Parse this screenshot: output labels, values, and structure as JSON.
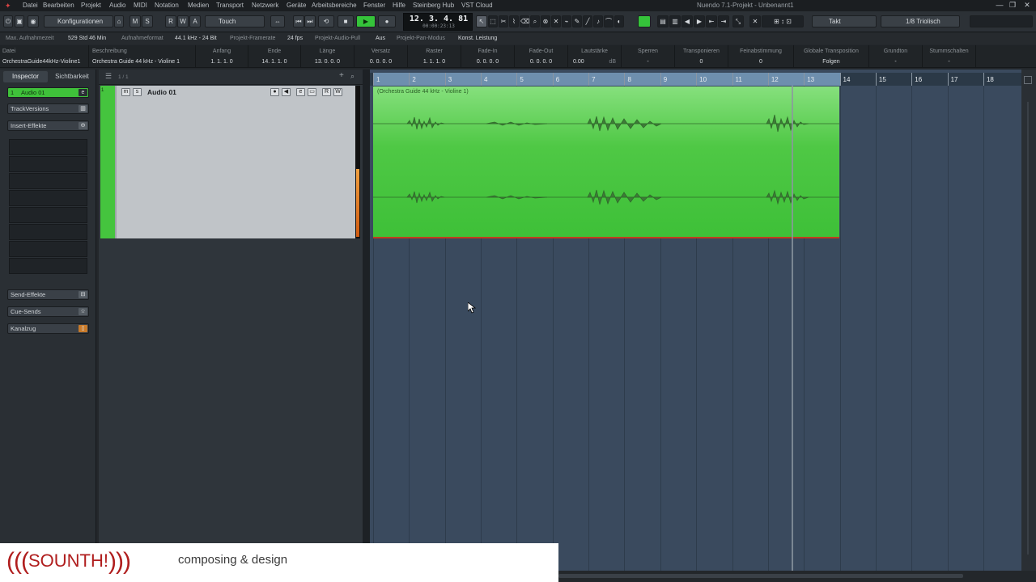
{
  "menubar": {
    "items": [
      "Datei",
      "Bearbeiten",
      "Projekt",
      "Audio",
      "MIDI",
      "Notation",
      "Medien",
      "Transport",
      "Netzwerk",
      "Geräte",
      "Arbeitsbereiche",
      "Fenster",
      "Hilfe",
      "Steinberg Hub",
      "VST Cloud"
    ],
    "window_title": "Nuendo 7.1-Projekt - Unbenannt1",
    "window_buttons": [
      "—",
      "❐",
      "✕"
    ]
  },
  "toolbar": {
    "config_label": "Konfigurationen",
    "msrwa": [
      "M",
      "S",
      "R",
      "W",
      "A"
    ],
    "automation_mode": "Touch",
    "timecode_main": "12. 3. 4. 81",
    "timecode_sub": "00:00:23:13",
    "snap_mode": "Takt",
    "quantize": "1/8 Triolisch"
  },
  "statusbar": {
    "max_rec_label": "Max. Aufnahmezeit",
    "max_rec_value": "529 Std 46 Min",
    "format_label": "Aufnahmeformat",
    "format_value": "44.1 kHz - 24 Bit",
    "framerate_label": "Projekt-Framerate",
    "framerate_value": "24 fps",
    "pull_label": "Projekt-Audio-Pull",
    "pull_value": "Aus",
    "pan_label": "Projekt-Pan-Modus",
    "pan_value": "Konst. Leistung"
  },
  "infoline": {
    "columns": [
      {
        "label": "Datei",
        "value": "OrchestraGuide44kHz-Violine1"
      },
      {
        "label": "Beschreibung",
        "value": "Orchestra Guide 44 kHz - Violine 1"
      },
      {
        "label": "Anfang",
        "value": "1. 1. 1.   0"
      },
      {
        "label": "Ende",
        "value": "14. 1. 1.   0"
      },
      {
        "label": "Länge",
        "value": "13. 0. 0.   0"
      },
      {
        "label": "Versatz",
        "value": "0. 0. 0.   0"
      },
      {
        "label": "Raster",
        "value": "1. 1. 1.   0"
      },
      {
        "label": "Fade-In",
        "value": "0. 0. 0.   0"
      },
      {
        "label": "Fade-Out",
        "value": "0. 0. 0.   0"
      },
      {
        "label": "Lautstärke",
        "value": "0.00"
      },
      {
        "label": "Sperren",
        "value": "-"
      },
      {
        "label": "Transponieren",
        "value": "0"
      },
      {
        "label": "Feinabstimmung",
        "value": "0"
      },
      {
        "label": "Globale Transposition",
        "value": "Folgen"
      },
      {
        "label": "Grundton",
        "value": "-"
      },
      {
        "label": "Stummschalten",
        "value": "-"
      }
    ],
    "volume_unit": "dB"
  },
  "inspector": {
    "tab_inspector": "Inspector",
    "tab_visibility": "Sichtbarkeit",
    "track_number": "1",
    "track_name": "Audio 01",
    "track_versions": "TrackVersions",
    "insert_effects": "Insert-Effekte",
    "send_effects": "Send-Effekte",
    "cue_sends": "Cue-Sends",
    "channel_strip": "Kanalzug"
  },
  "tracklist": {
    "track_count": "1 / 1",
    "track_number": "1",
    "track_name": "Audio 01",
    "buttons": [
      "m",
      "s"
    ],
    "right_buttons": [
      "●",
      "◀",
      "e",
      "▭",
      "R",
      "W"
    ]
  },
  "project": {
    "bar_numbers": [
      "1",
      "2",
      "3",
      "4",
      "5",
      "6",
      "7",
      "8",
      "9",
      "10",
      "11",
      "12",
      "13",
      "14",
      "15",
      "16",
      "17",
      "18"
    ],
    "event_name": "Orchestra Guide 44 kHz - Violine 1"
  },
  "logo": {
    "brand_left": "(((",
    "brand_name": "SOUNTH!",
    "brand_right": ")))",
    "tagline": "composing & design"
  },
  "colors": {
    "track_color": "#45c43e",
    "play_button": "#35c33a",
    "project_bg": "#3a4a5e",
    "logo_red": "#b01e1e"
  }
}
